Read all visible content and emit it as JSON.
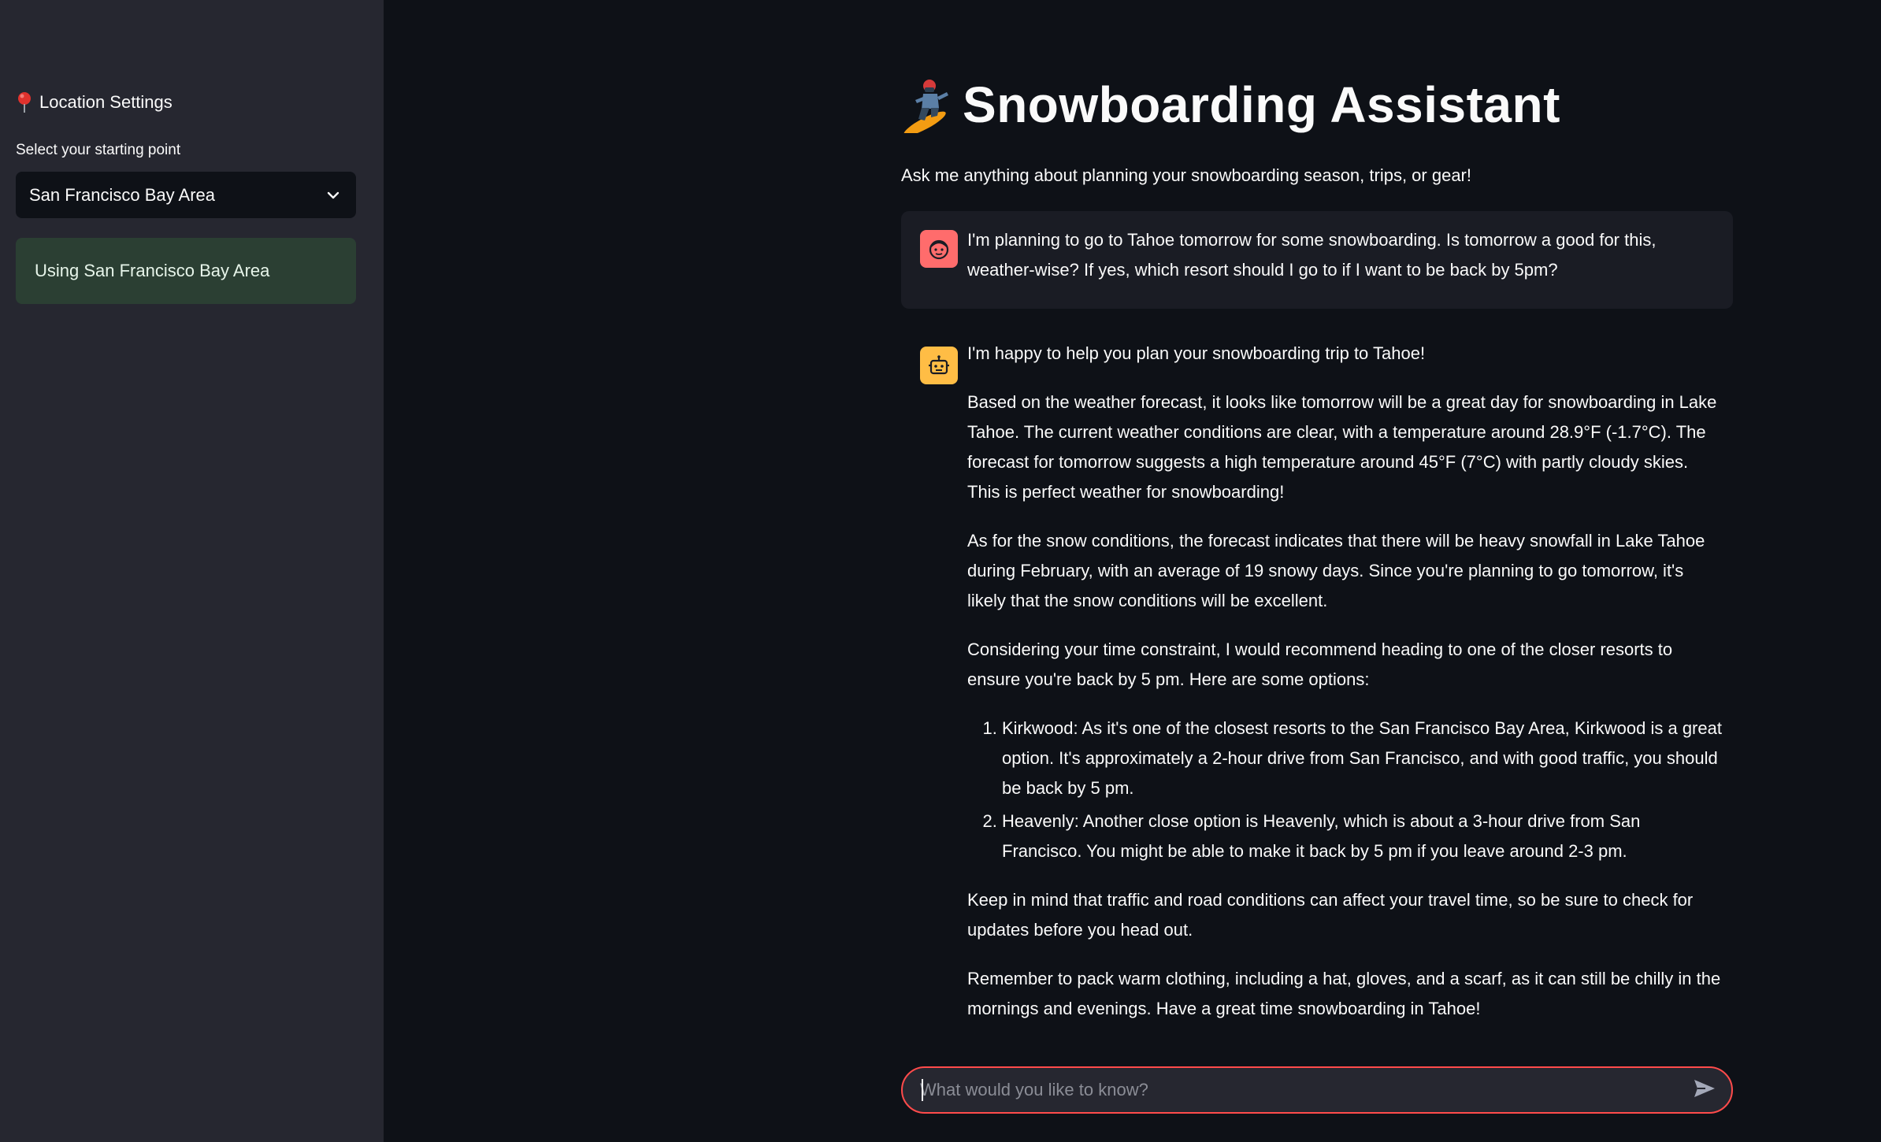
{
  "sidebar": {
    "header": "Location Settings",
    "select_label": "Select your starting point",
    "selected_location": "San Francisco Bay Area",
    "status": "Using San Francisco Bay Area"
  },
  "main": {
    "title": "Snowboarding Assistant",
    "subtitle": "Ask me anything about planning your snowboarding season, trips, or gear!"
  },
  "messages": {
    "user": "I'm planning to go to Tahoe tomorrow for some snowboarding. Is tomorrow a good for this, weather-wise? If yes, which resort should I go to if I want to be back by 5pm?",
    "assistant": {
      "p1": "I'm happy to help you plan your snowboarding trip to Tahoe!",
      "p2": "Based on the weather forecast, it looks like tomorrow will be a great day for snowboarding in Lake Tahoe. The current weather conditions are clear, with a temperature around 28.9°F (-1.7°C). The forecast for tomorrow suggests a high temperature around 45°F (7°C) with partly cloudy skies. This is perfect weather for snowboarding!",
      "p3": "As for the snow conditions, the forecast indicates that there will be heavy snowfall in Lake Tahoe during February, with an average of 19 snowy days. Since you're planning to go tomorrow, it's likely that the snow conditions will be excellent.",
      "p4": "Considering your time constraint, I would recommend heading to one of the closer resorts to ensure you're back by 5 pm. Here are some options:",
      "options": [
        "Kirkwood: As it's one of the closest resorts to the San Francisco Bay Area, Kirkwood is a great option. It's approximately a 2-hour drive from San Francisco, and with good traffic, you should be back by 5 pm.",
        "Heavenly: Another close option is Heavenly, which is about a 3-hour drive from San Francisco. You might be able to make it back by 5 pm if you leave around 2-3 pm."
      ],
      "p5": "Keep in mind that traffic and road conditions can affect your travel time, so be sure to check for updates before you head out.",
      "p6": "Remember to pack warm clothing, including a hat, gloves, and a scarf, as it can still be chilly in the mornings and evenings. Have a great time snowboarding in Tahoe!"
    }
  },
  "chat_input": {
    "placeholder": "What would you like to know?"
  },
  "icons": {
    "pin": "map-pin-icon",
    "chevron": "chevron-down-icon",
    "snowboarder": "snowboarder-icon",
    "user_avatar": "user-face-icon",
    "bot_avatar": "robot-face-icon",
    "send": "send-icon"
  },
  "colors": {
    "background": "#0e1117",
    "sidebar": "#262730",
    "user_avatar": "#ff6c6c",
    "bot_avatar": "#ffbd45",
    "status_success": "#2b3f33",
    "input_border": "#ff4b4b"
  }
}
